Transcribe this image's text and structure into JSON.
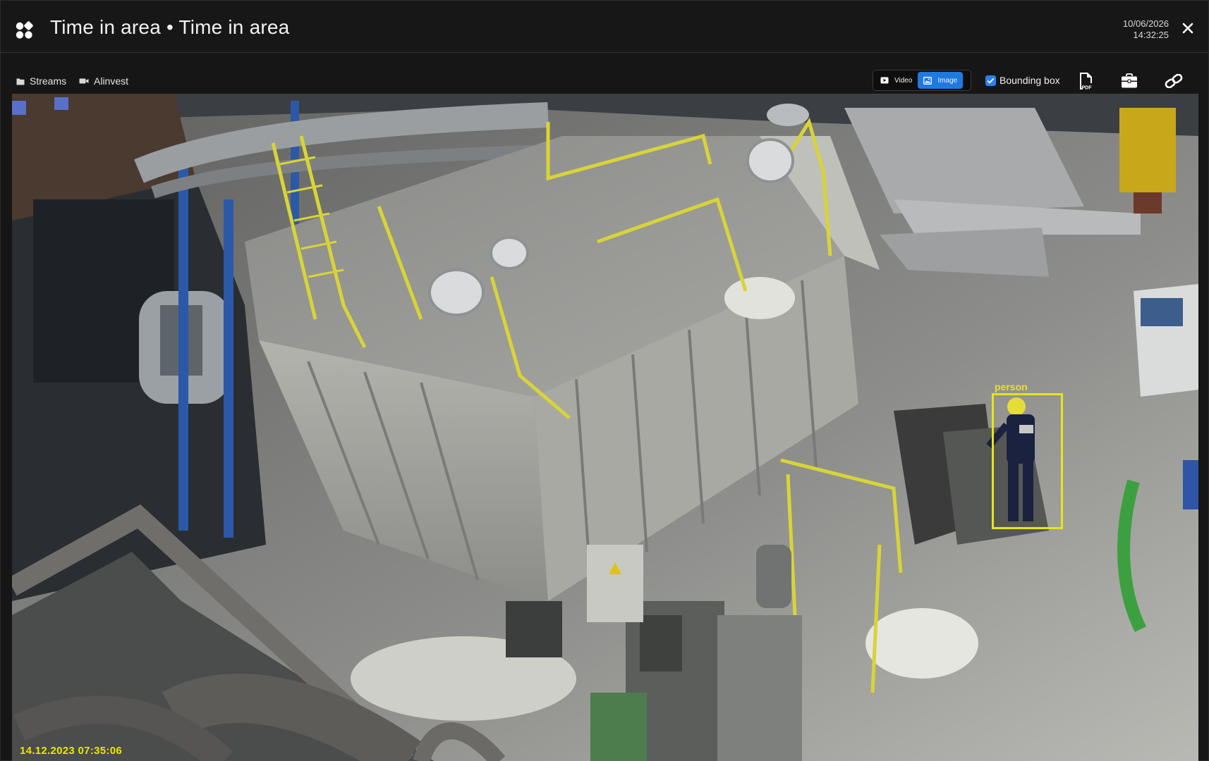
{
  "header": {
    "title": "Time in area • Time in area",
    "date": "10/06/2026",
    "time": "14:32:25"
  },
  "breadcrumb": {
    "streams": "Streams",
    "camera": "Alinvest"
  },
  "toolbar": {
    "view_modes": [
      {
        "label": "Video",
        "active": false
      },
      {
        "label": "Image",
        "active": true
      }
    ],
    "bounding_box_label": "Bounding box",
    "bounding_box_checked": true,
    "icons": [
      "pdf-icon",
      "briefcase-icon",
      "link-icon"
    ]
  },
  "frame": {
    "timestamp": "14.12.2023 07:35:06",
    "detection": {
      "label": "person",
      "color": "#e5e51a"
    }
  },
  "colors": {
    "accent": "#1f7ae0",
    "background": "#161616",
    "timestamp": "#e8e800"
  }
}
